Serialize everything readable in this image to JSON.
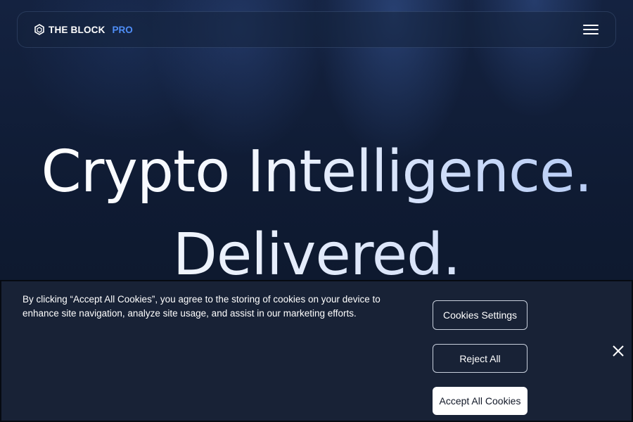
{
  "nav": {
    "logo_text": "THE BLOCK",
    "logo_pro": "PRO",
    "menu_icon": "hamburger-menu-icon"
  },
  "hero": {
    "line1": "Crypto Intelligence.",
    "line2": "Delivered."
  },
  "cookie_banner": {
    "message": "By clicking “Accept All Cookies”, you agree to the storing of cookies on your device to enhance site navigation, analyze site usage, and assist in our marketing efforts.",
    "settings_label": "Cookies Settings",
    "reject_label": "Reject All",
    "accept_label": "Accept All Cookies",
    "close_icon": "close-icon"
  },
  "colors": {
    "accent": "#4f8ef7",
    "background": "#0b1220",
    "banner": "#182236"
  }
}
